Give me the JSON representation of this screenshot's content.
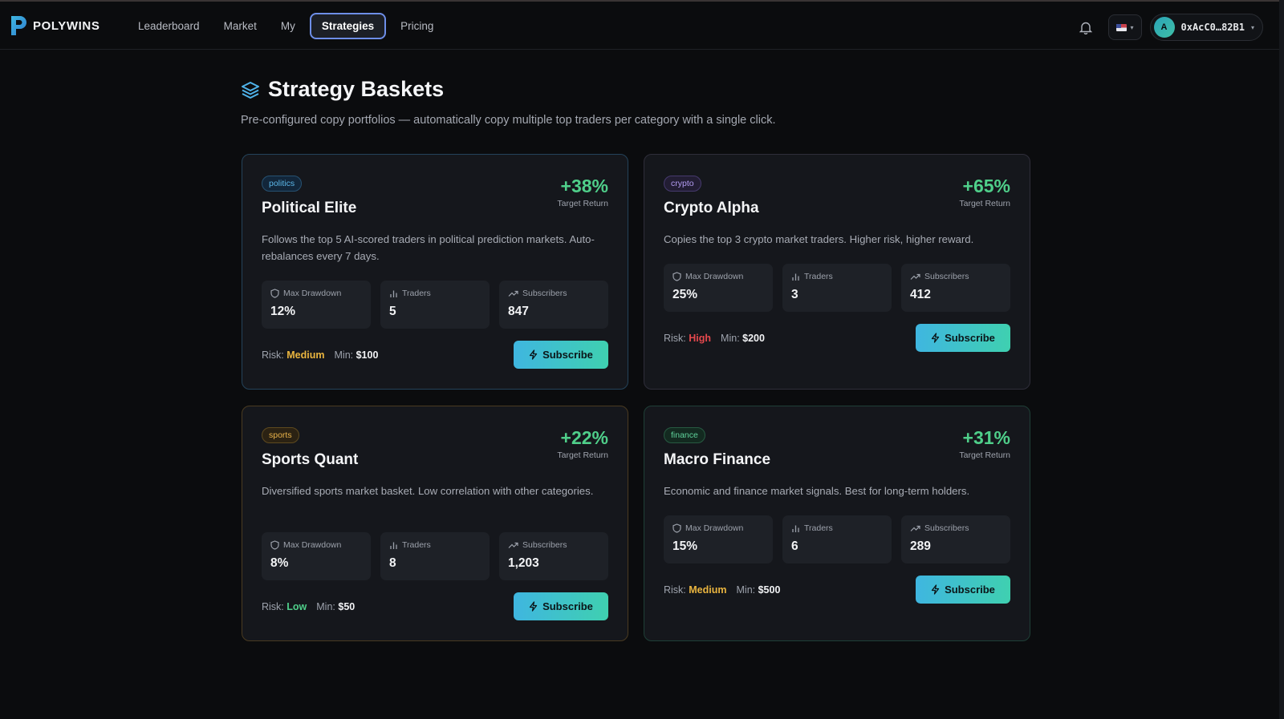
{
  "brand": {
    "name": "POLYWINS"
  },
  "nav": {
    "items": [
      {
        "label": "Leaderboard",
        "active": false
      },
      {
        "label": "Market",
        "active": false
      },
      {
        "label": "My",
        "active": false
      },
      {
        "label": "Strategies",
        "active": true
      },
      {
        "label": "Pricing",
        "active": false
      }
    ]
  },
  "header": {
    "wallet_initial": "A",
    "wallet_address": "0xAcC0…82B1"
  },
  "page": {
    "title": "Strategy Baskets",
    "subtitle": "Pre-configured copy portfolios — automatically copy multiple top traders per category with a single click."
  },
  "labels": {
    "target_return": "Target Return",
    "max_drawdown": "Max Drawdown",
    "traders": "Traders",
    "subscribers": "Subscribers",
    "risk": "Risk:",
    "min": "Min:",
    "subscribe": "Subscribe"
  },
  "baskets": [
    {
      "category": "politics",
      "title": "Political Elite",
      "target_return": "+38%",
      "description": "Follows the top 5 AI-scored traders in political prediction markets. Auto-rebalances every 7 days.",
      "max_drawdown": "12%",
      "traders": "5",
      "subscribers": "847",
      "risk": "Medium",
      "min": "$100"
    },
    {
      "category": "crypto",
      "title": "Crypto Alpha",
      "target_return": "+65%",
      "description": "Copies the top 3 crypto market traders. Higher risk, higher reward.",
      "max_drawdown": "25%",
      "traders": "3",
      "subscribers": "412",
      "risk": "High",
      "min": "$200"
    },
    {
      "category": "sports",
      "title": "Sports Quant",
      "target_return": "+22%",
      "description": "Diversified sports market basket. Low correlation with other categories.",
      "max_drawdown": "8%",
      "traders": "8",
      "subscribers": "1,203",
      "risk": "Low",
      "min": "$50"
    },
    {
      "category": "finance",
      "title": "Macro Finance",
      "target_return": "+31%",
      "description": "Economic and finance market signals. Best for long-term holders.",
      "max_drawdown": "15%",
      "traders": "6",
      "subscribers": "289",
      "risk": "Medium",
      "min": "$500"
    }
  ],
  "colors": {
    "accent": "#3fb6e0",
    "positive": "#4fcf8a",
    "risk_medium": "#eab53f",
    "risk_high": "#e5484d",
    "risk_low": "#4fcf8a"
  }
}
